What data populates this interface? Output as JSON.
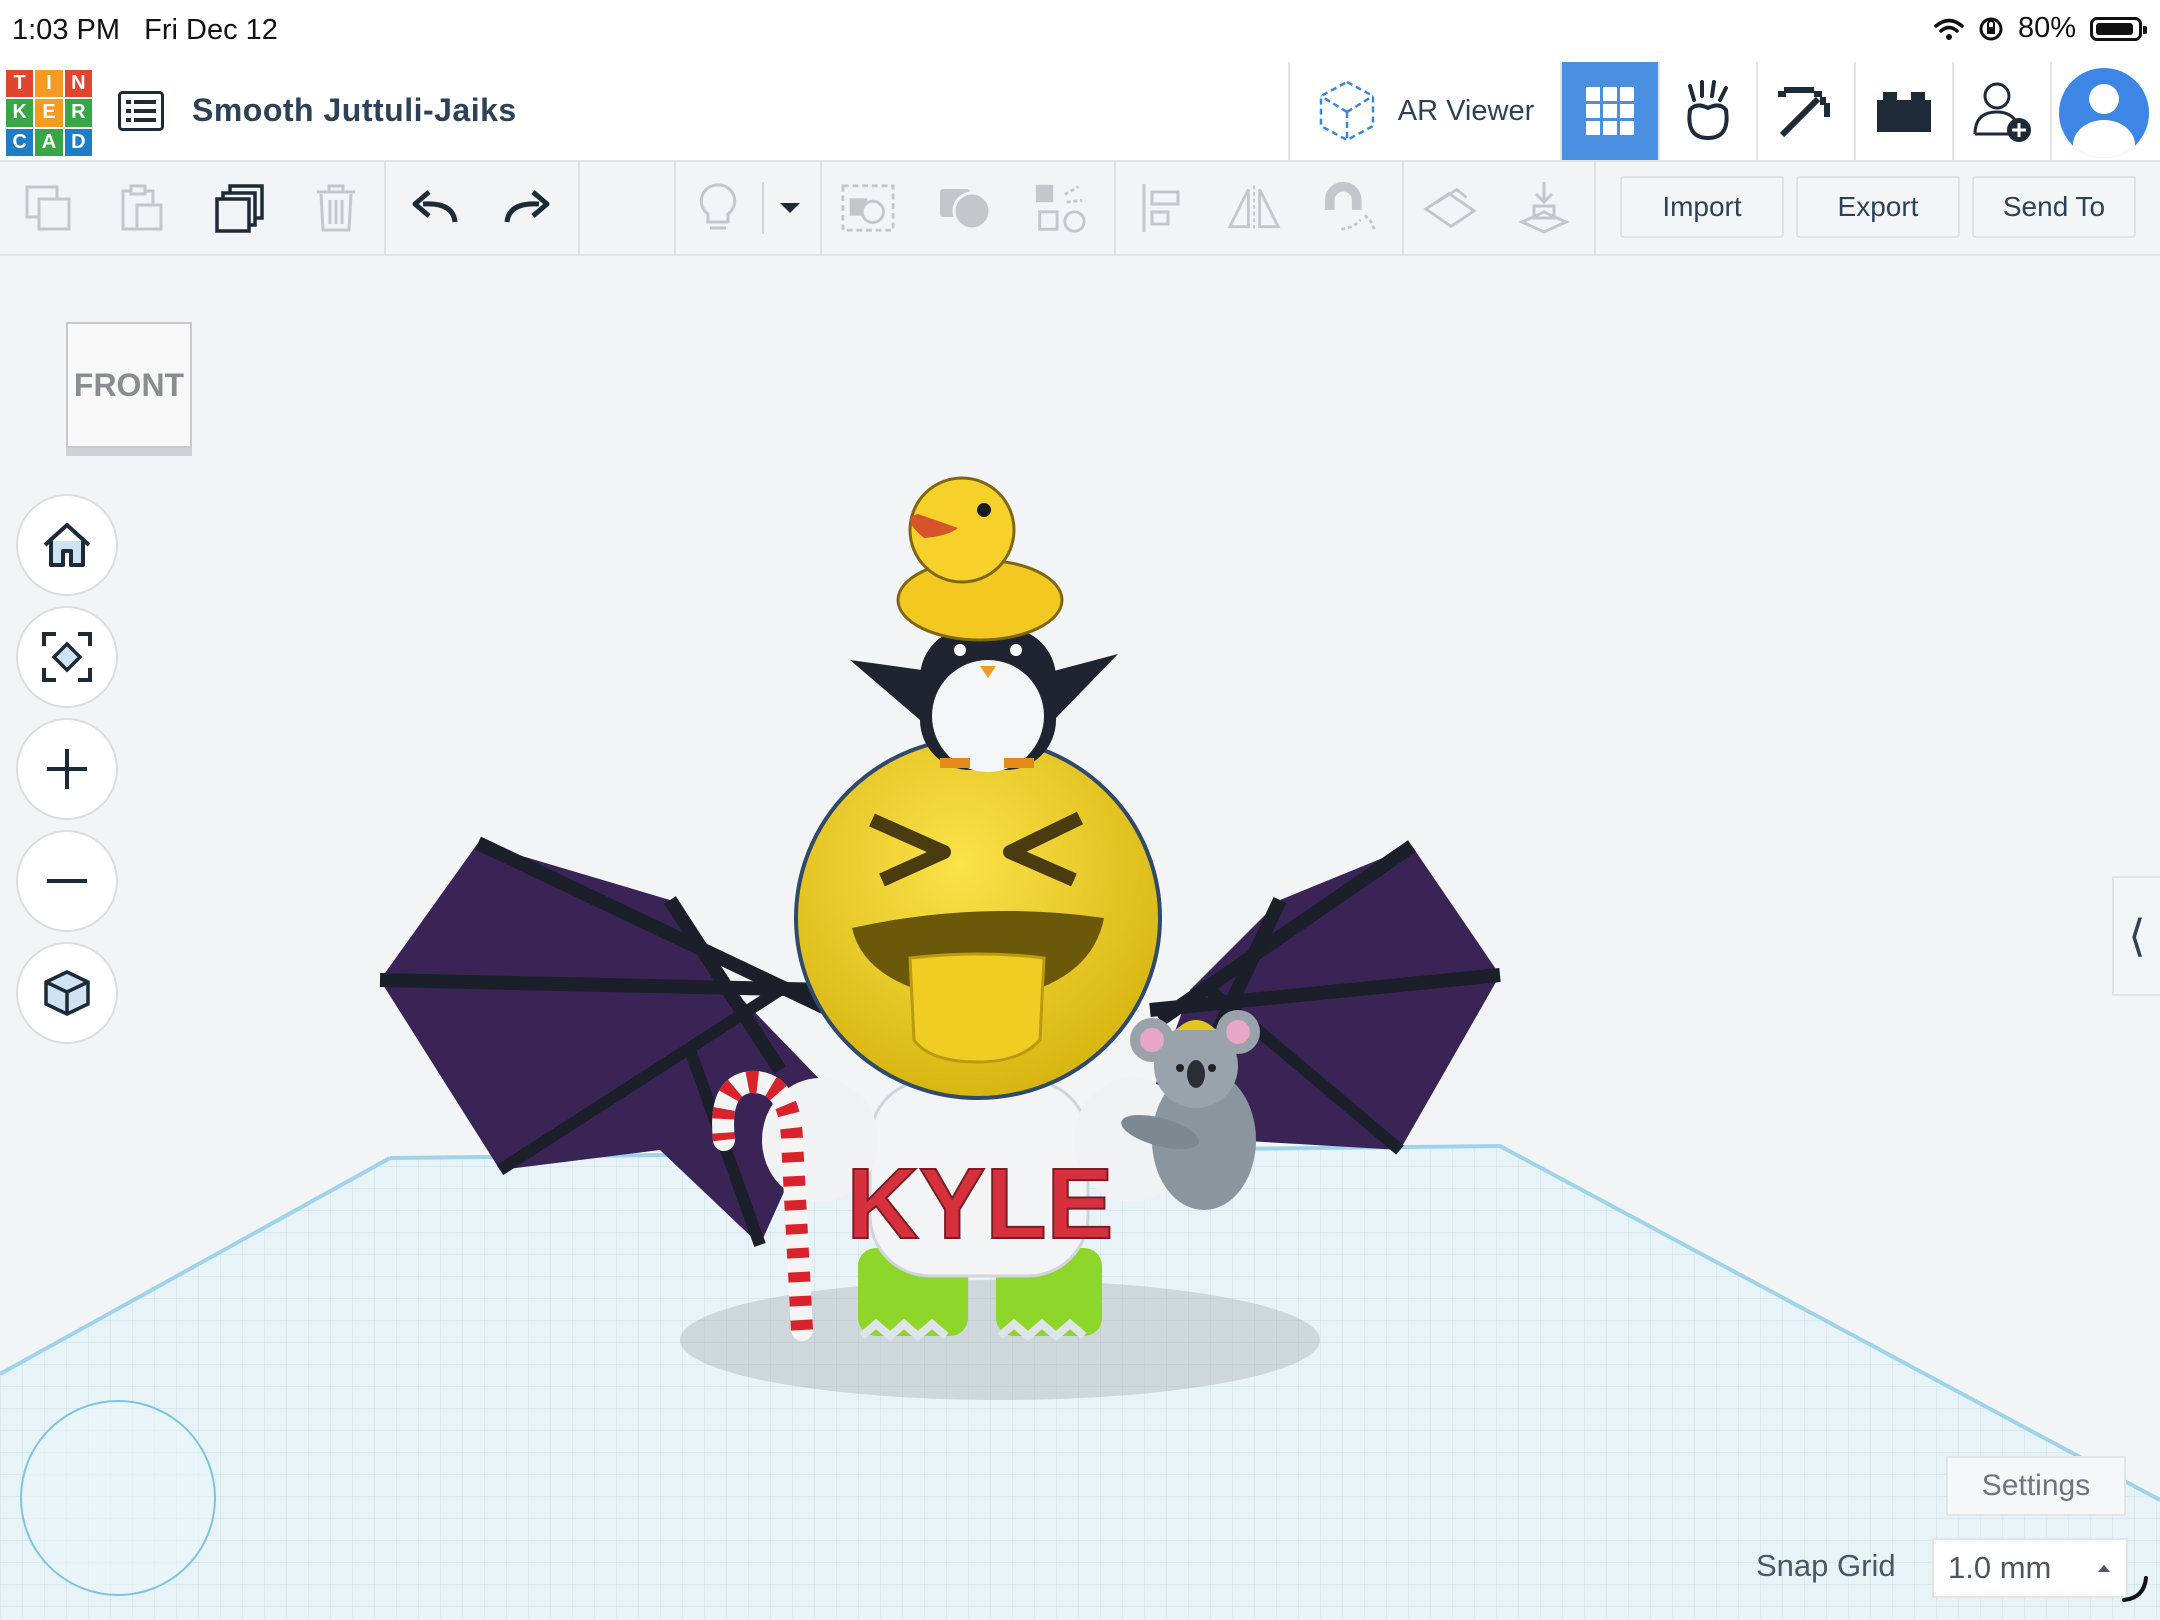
{
  "status_bar": {
    "time": "1:03 PM",
    "date": "Fri Dec 12",
    "battery": "80%",
    "battery_level": 0.8
  },
  "header": {
    "logo_letters": [
      "T",
      "I",
      "N",
      "K",
      "E",
      "R",
      "C",
      "A",
      "D"
    ],
    "design_title": "Smooth Juttuli-Jaiks",
    "ar_viewer_label": "AR Viewer",
    "icons": [
      "ar-cube-icon",
      "grid-3d-icon",
      "codeblocks-icon",
      "pickaxe-icon",
      "brick-icon",
      "add-user-icon",
      "avatar"
    ]
  },
  "toolbar": {
    "import_label": "Import",
    "export_label": "Export",
    "send_to_label": "Send To"
  },
  "workplane": {
    "viewcube_label": "FRONT",
    "settings_label": "Settings",
    "snap_grid_label": "Snap Grid",
    "snap_grid_value": "1.0 mm",
    "shirt_text": "KYLE"
  },
  "colors": {
    "accent": "#4b8fe0",
    "grid": "#cfe6ef",
    "logo_red": "#e0452d",
    "logo_orange": "#f59a23",
    "logo_green": "#37a647",
    "logo_blue": "#1f7dc6"
  }
}
